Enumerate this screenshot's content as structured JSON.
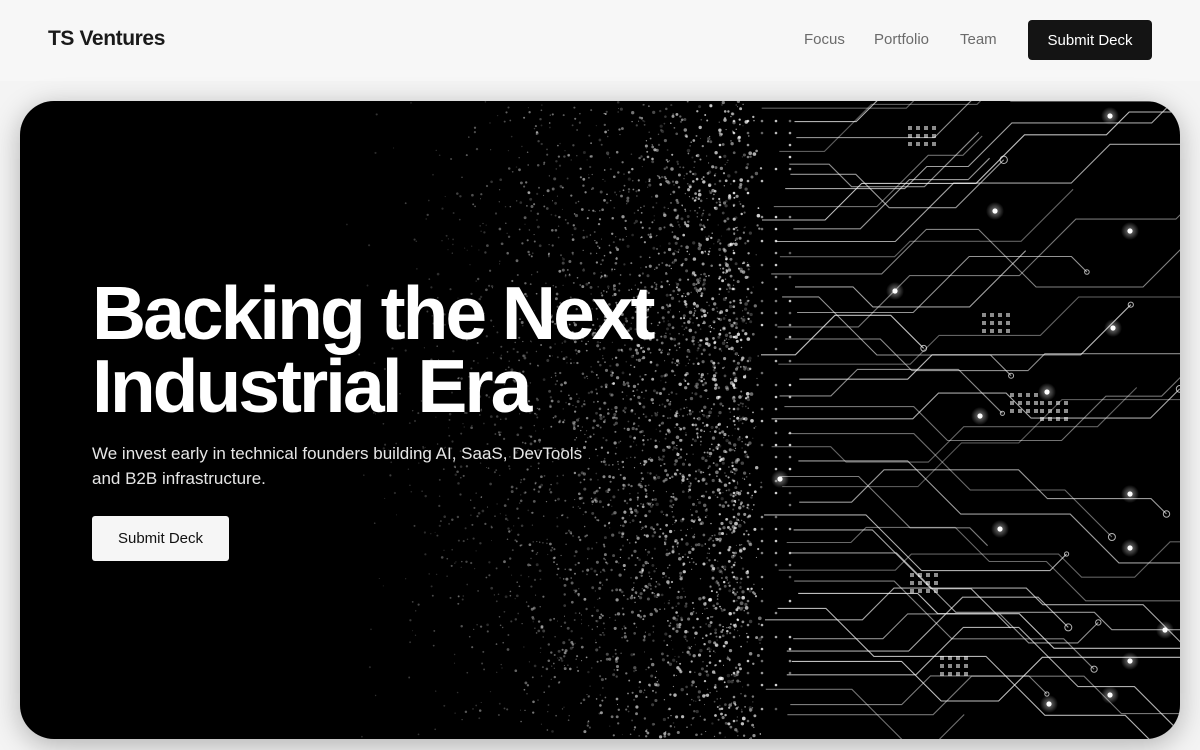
{
  "header": {
    "brand": "TS Ventures",
    "nav": [
      {
        "label": "Focus"
      },
      {
        "label": "Portfolio"
      },
      {
        "label": "Team"
      }
    ],
    "cta_label": "Submit Deck"
  },
  "hero": {
    "headline_line1": "Backing the Next",
    "headline_line2": "Industrial Era",
    "subtitle": "We invest early in technical founders building AI, SaaS, DevTools and B2B infrastructure.",
    "cta_label": "Submit Deck",
    "background_icon": "circuit-board-particles-graphic"
  },
  "colors": {
    "page_bg": "#f4f4f4",
    "hero_bg": "#000000",
    "primary_button": "#141414",
    "hero_button": "#f6f6f6"
  }
}
